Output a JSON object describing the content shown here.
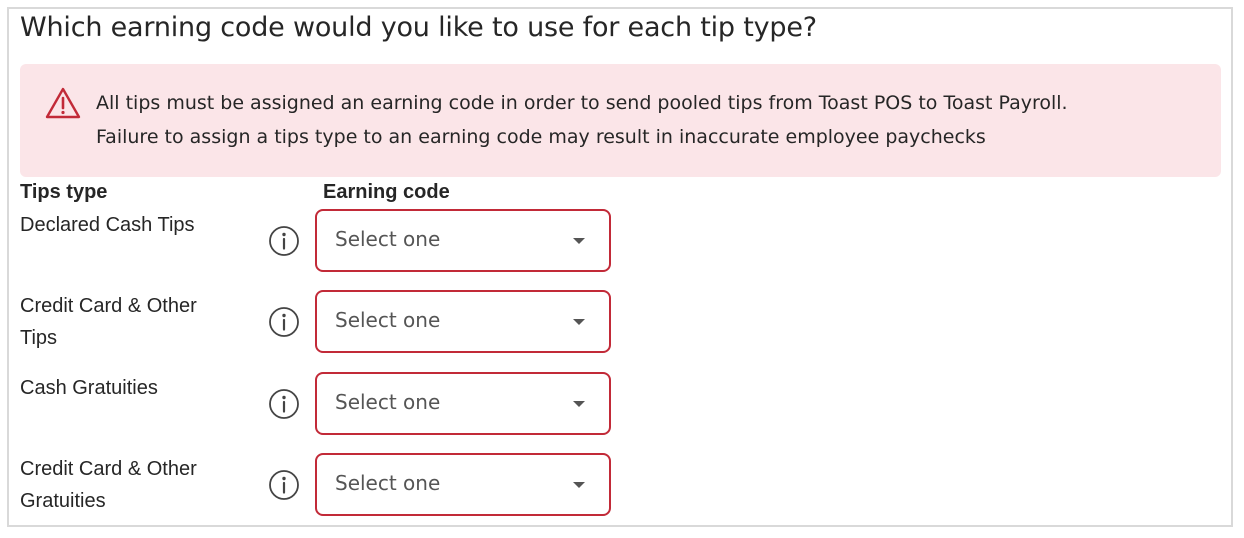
{
  "heading": "Which earning code would you like to use for each tip type?",
  "alert": {
    "icon": "warning-triangle-icon",
    "line1": "All tips must be assigned an earning code in order to send pooled tips from Toast POS to Toast Payroll.",
    "line2": "Failure to assign a tips type to an earning code may result in inaccurate employee paychecks",
    "color": "#c22a38",
    "background": "#fbe5e8"
  },
  "columns": {
    "tips_type": "Tips type",
    "earning_code": "Earning code"
  },
  "rows": [
    {
      "label_line1": "Declared Cash Tips",
      "label_line2": "",
      "info_icon": "info-icon",
      "select_value": "Select one"
    },
    {
      "label_line1": "Credit Card & Other",
      "label_line2": "Tips",
      "info_icon": "info-icon",
      "select_value": "Select one"
    },
    {
      "label_line1": "Cash Gratuities",
      "label_line2": "",
      "info_icon": "info-icon",
      "select_value": "Select one"
    },
    {
      "label_line1": "Credit Card & Other",
      "label_line2": "Gratuities",
      "info_icon": "info-icon",
      "select_value": "Select one"
    }
  ]
}
